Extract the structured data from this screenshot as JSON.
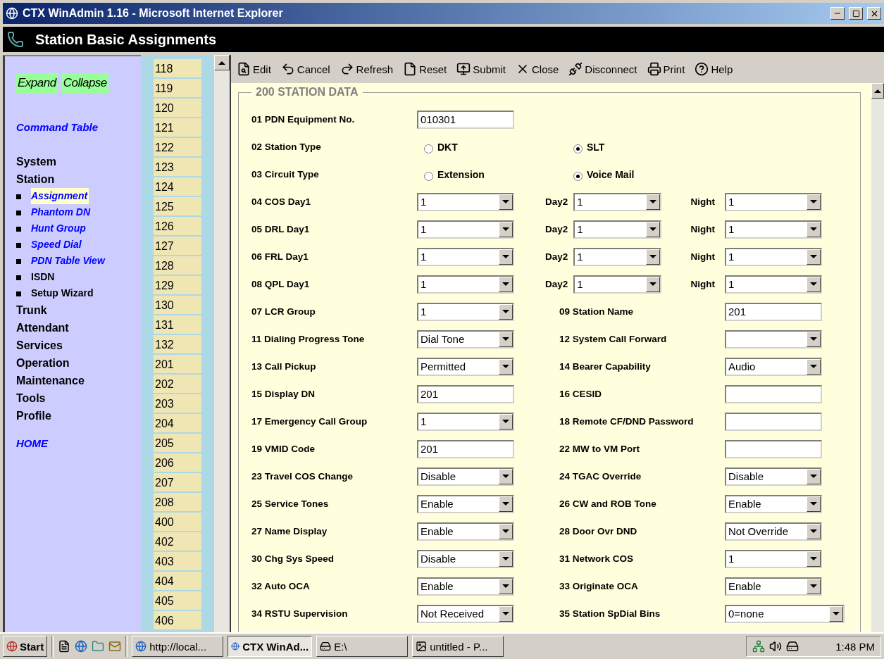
{
  "window": {
    "title": "CTX WinAdmin 1.16 - Microsoft Internet Explorer"
  },
  "header": {
    "title": "Station Basic Assignments"
  },
  "sidebar": {
    "buttons": [
      "Expand",
      "Collapse"
    ],
    "command_link": "Command Table",
    "menu": [
      {
        "label": "System"
      },
      {
        "label": "Station",
        "children": [
          {
            "label": "Assignment",
            "kind": "link",
            "selected": true
          },
          {
            "label": "Phantom DN",
            "kind": "link",
            "selected": false
          },
          {
            "label": "Hunt Group",
            "kind": "link",
            "selected": false
          },
          {
            "label": "Speed Dial",
            "kind": "link",
            "selected": false
          },
          {
            "label": "PDN Table View",
            "kind": "link",
            "selected": false
          },
          {
            "label": "ISDN",
            "kind": "plain",
            "selected": false
          },
          {
            "label": "Setup Wizard",
            "kind": "plain",
            "selected": false
          }
        ]
      },
      {
        "label": "Trunk"
      },
      {
        "label": "Attendant"
      },
      {
        "label": "Services"
      },
      {
        "label": "Operation"
      },
      {
        "label": "Maintenance"
      },
      {
        "label": "Tools"
      },
      {
        "label": "Profile"
      }
    ],
    "home_link": "HOME"
  },
  "station_list": [
    "118",
    "119",
    "120",
    "121",
    "122",
    "123",
    "124",
    "125",
    "126",
    "127",
    "128",
    "129",
    "130",
    "131",
    "132",
    "201",
    "202",
    "203",
    "204",
    "205",
    "206",
    "207",
    "208",
    "400",
    "402",
    "403",
    "404",
    "405",
    "406"
  ],
  "toolbar": [
    {
      "label": "Edit",
      "kind": "edit"
    },
    {
      "label": "Cancel",
      "kind": "cancel"
    },
    {
      "label": "Refresh",
      "kind": "refresh"
    },
    {
      "label": "Reset",
      "kind": "reset"
    },
    {
      "label": "Submit",
      "kind": "submit"
    },
    {
      "label": "Close",
      "kind": "close"
    },
    {
      "label": "Disconnect",
      "kind": "disconnect"
    },
    {
      "label": "Print",
      "kind": "print"
    },
    {
      "label": "Help",
      "kind": "help"
    }
  ],
  "form": {
    "legend": "200 STATION DATA",
    "rows": [
      {
        "label": "01 PDN Equipment No.",
        "field": {
          "kind": "text",
          "value": "010301"
        }
      },
      {
        "label": "02 Station Type",
        "field": {
          "kind": "radio",
          "options": [
            {
              "label": "DKT",
              "selected": false
            },
            {
              "label": "SLT",
              "selected": true
            }
          ]
        }
      },
      {
        "label": "03 Circuit Type",
        "field": {
          "kind": "radio",
          "options": [
            {
              "label": "Extension",
              "selected": false
            },
            {
              "label": "Voice Mail",
              "selected": true
            }
          ]
        }
      },
      {
        "label": "04 COS Day1",
        "field": {
          "kind": "select",
          "value": "1"
        },
        "day2": {
          "label": "Day2",
          "field": {
            "kind": "select",
            "value": "1"
          }
        },
        "night": {
          "label": "Night",
          "field": {
            "kind": "select",
            "value": "1"
          }
        }
      },
      {
        "label": "05 DRL Day1",
        "field": {
          "kind": "select",
          "value": "1"
        },
        "day2": {
          "label": "Day2",
          "field": {
            "kind": "select",
            "value": "1"
          }
        },
        "night": {
          "label": "Night",
          "field": {
            "kind": "select",
            "value": "1"
          }
        }
      },
      {
        "label": "06 FRL Day1",
        "field": {
          "kind": "select",
          "value": "1"
        },
        "day2": {
          "label": "Day2",
          "field": {
            "kind": "select",
            "value": "1"
          }
        },
        "night": {
          "label": "Night",
          "field": {
            "kind": "select",
            "value": "1"
          }
        }
      },
      {
        "label": "08 QPL Day1",
        "field": {
          "kind": "select",
          "value": "1"
        },
        "day2": {
          "label": "Day2",
          "field": {
            "kind": "select",
            "value": "1"
          }
        },
        "night": {
          "label": "Night",
          "field": {
            "kind": "select",
            "value": "1"
          }
        }
      },
      {
        "label": "07 LCR Group",
        "field": {
          "kind": "select",
          "value": "1"
        },
        "right": {
          "label": "09 Station Name",
          "field": {
            "kind": "text",
            "value": "201"
          }
        }
      },
      {
        "label": "11 Dialing Progress Tone",
        "field": {
          "kind": "select",
          "value": "Dial Tone"
        },
        "right": {
          "label": "12 System Call Forward",
          "field": {
            "kind": "select"
          }
        }
      },
      {
        "label": "13 Call Pickup",
        "field": {
          "kind": "select",
          "value": "Permitted"
        },
        "right": {
          "label": "14 Bearer Capability",
          "field": {
            "kind": "select",
            "value": "Audio"
          }
        }
      },
      {
        "label": "15 Display DN",
        "field": {
          "kind": "text",
          "value": "201"
        },
        "right": {
          "label": "16 CESID",
          "field": {
            "kind": "text"
          }
        }
      },
      {
        "label": "17 Emergency Call Group",
        "field": {
          "kind": "select",
          "value": "1"
        },
        "right": {
          "label": "18 Remote CF/DND Password",
          "field": {
            "kind": "text"
          }
        }
      },
      {
        "label": "19 VMID Code",
        "field": {
          "kind": "text",
          "value": "201"
        },
        "right": {
          "label": "22 MW to VM Port",
          "field": {
            "kind": "text"
          }
        }
      },
      {
        "label": "23 Travel COS Change",
        "field": {
          "kind": "select",
          "value": "Disable"
        },
        "right": {
          "label": "24 TGAC Override",
          "field": {
            "kind": "select",
            "value": "Disable"
          }
        }
      },
      {
        "label": "25 Service Tones",
        "field": {
          "kind": "select",
          "value": "Enable"
        },
        "right": {
          "label": "26 CW and ROB Tone",
          "field": {
            "kind": "select",
            "value": "Enable"
          }
        }
      },
      {
        "label": "27 Name Display",
        "field": {
          "kind": "select",
          "value": "Enable"
        },
        "right": {
          "label": "28 Door Ovr DND",
          "field": {
            "kind": "select",
            "value": "Not Override"
          }
        }
      },
      {
        "label": "30 Chg Sys Speed",
        "field": {
          "kind": "select",
          "value": "Disable"
        },
        "right": {
          "label": "31 Network COS",
          "field": {
            "kind": "select",
            "value": "1"
          }
        }
      },
      {
        "label": "32 Auto OCA",
        "field": {
          "kind": "select",
          "value": "Enable"
        },
        "right": {
          "label": "33 Originate OCA",
          "field": {
            "kind": "select",
            "value": "Enable"
          }
        }
      },
      {
        "label": "34 RSTU Supervision",
        "field": {
          "kind": "select",
          "value": "Not Received"
        },
        "right": {
          "label": "35 Station SpDial Bins",
          "field": {
            "kind": "select",
            "value": "0=none"
          }
        }
      }
    ]
  },
  "taskbar": {
    "start": "Start",
    "tasks": [
      {
        "label": "http://local...",
        "selected": false
      },
      {
        "label": "CTX WinAd...",
        "selected": true
      },
      {
        "label": "E:\\",
        "selected": false
      },
      {
        "label": "untitled - P...",
        "selected": false
      }
    ],
    "clock": "1:48 PM"
  }
}
